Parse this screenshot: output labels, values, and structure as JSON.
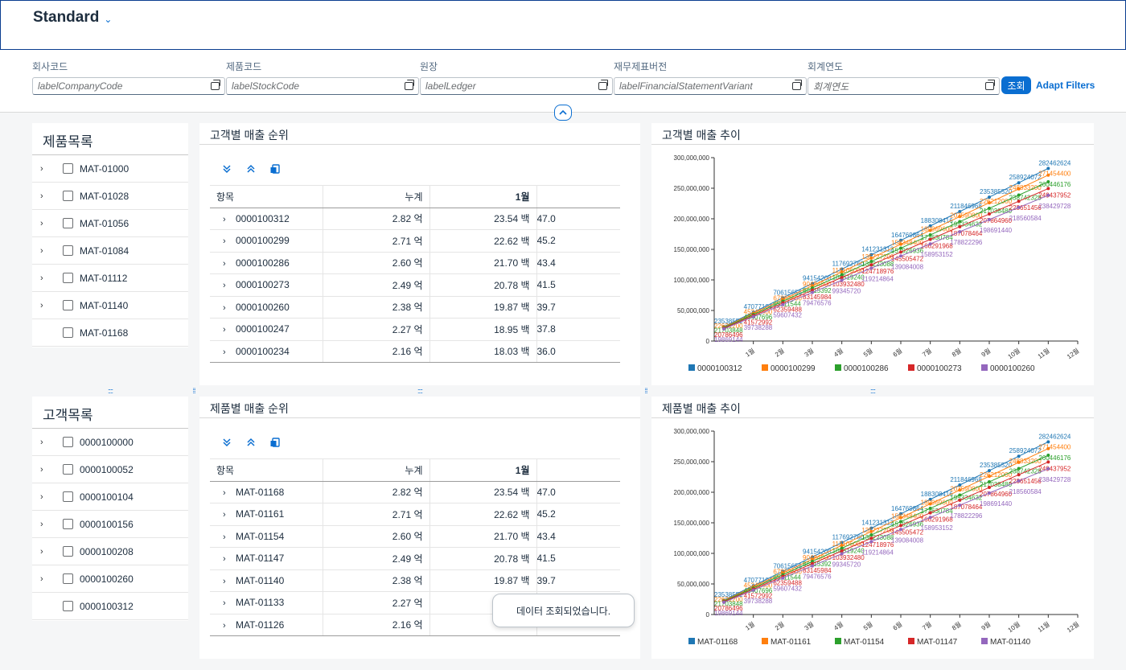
{
  "header": {
    "variant_title": "Standard"
  },
  "filters": {
    "fields": [
      {
        "label": "회사코드",
        "placeholder": "labelCompanyCode"
      },
      {
        "label": "제품코드",
        "placeholder": "labelStockCode"
      },
      {
        "label": "원장",
        "placeholder": "labelLedger"
      },
      {
        "label": "재무제표버전",
        "placeholder": "labelFinancialStatementVariant"
      },
      {
        "label": "회계연도",
        "placeholder": "회계연도"
      }
    ],
    "go_label": "조회",
    "adapt_label": "Adapt Filters"
  },
  "product_list": {
    "title": "제품목록",
    "items": [
      "MAT-01000",
      "MAT-01028",
      "MAT-01056",
      "MAT-01084",
      "MAT-01112",
      "MAT-01140",
      "MAT-01168"
    ]
  },
  "customer_list": {
    "title": "고객목록",
    "items": [
      "0000100000",
      "0000100052",
      "0000100104",
      "0000100156",
      "0000100208",
      "0000100260",
      "0000100312"
    ]
  },
  "customer_rank": {
    "title": "고객별 매출 순위",
    "columns": [
      "항목",
      "누계",
      "1월",
      ""
    ],
    "rows": [
      [
        "0000100312",
        "2.82 억",
        "23.54 백",
        "47.0"
      ],
      [
        "0000100299",
        "2.71 억",
        "22.62 백",
        "45.2"
      ],
      [
        "0000100286",
        "2.60 억",
        "21.70 백",
        "43.4"
      ],
      [
        "0000100273",
        "2.49 억",
        "20.78 백",
        "41.5"
      ],
      [
        "0000100260",
        "2.38 억",
        "19.87 백",
        "39.7"
      ],
      [
        "0000100247",
        "2.27 억",
        "18.95 백",
        "37.8"
      ],
      [
        "0000100234",
        "2.16 억",
        "18.03 백",
        "36.0"
      ]
    ]
  },
  "product_rank": {
    "title": "제품별 매출 순위",
    "columns": [
      "항목",
      "누계",
      "1월",
      ""
    ],
    "rows": [
      [
        "MAT-01168",
        "2.82 억",
        "23.54 백",
        "47.0"
      ],
      [
        "MAT-01161",
        "2.71 억",
        "22.62 백",
        "45.2"
      ],
      [
        "MAT-01154",
        "2.60 억",
        "21.70 백",
        "43.4"
      ],
      [
        "MAT-01147",
        "2.49 억",
        "20.78 백",
        "41.5"
      ],
      [
        "MAT-01140",
        "2.38 억",
        "19.87 백",
        "39.7"
      ],
      [
        "MAT-01133",
        "2.27 억",
        "",
        ""
      ],
      [
        "MAT-01126",
        "2.16 억",
        "",
        ""
      ]
    ]
  },
  "toast": {
    "message": "데이터 조회되었습니다."
  },
  "chart_data": [
    {
      "type": "line",
      "title": "고객별 매출 추이",
      "categories": [
        "1월",
        "2월",
        "3월",
        "4월",
        "5월",
        "6월",
        "7월",
        "8월",
        "9월",
        "10월",
        "11월",
        "12월"
      ],
      "ylim": [
        0,
        300000000
      ],
      "yticks": [
        "0",
        "50,000,000",
        "100,000,000",
        "150,000,000",
        "200,000,000",
        "250,000,000",
        "300,000,000"
      ],
      "legend_position": "bottom",
      "series": [
        {
          "name": "0000100312",
          "color": "#1f77b4",
          "values": [
            23538552,
            47077104,
            70615656,
            94154208,
            117692760,
            141231312,
            164769864,
            188308416,
            211846968,
            235385520,
            258924072,
            282462624
          ]
        },
        {
          "name": "0000100299",
          "color": "#ff7f0e",
          "values": [
            22621200,
            45242400,
            67863600,
            90484800,
            113106000,
            135727200,
            158348400,
            180969600,
            203590800,
            226212000,
            248833200,
            271454400
          ]
        },
        {
          "name": "0000100286",
          "color": "#2ca02c",
          "values": [
            21703848,
            43407696,
            65111544,
            86815392,
            108519240,
            130223088,
            151926936,
            173630784,
            195334632,
            217038480,
            238742328,
            260446176
          ]
        },
        {
          "name": "0000100273",
          "color": "#d62728",
          "values": [
            20786496,
            41572992,
            62359488,
            83145984,
            103932480,
            124718976,
            145505472,
            166291968,
            187078464,
            207864960,
            228651456,
            249437952
          ]
        },
        {
          "name": "0000100260",
          "color": "#9467bd",
          "values": [
            19869144,
            39738288,
            59607432,
            79476576,
            99345720,
            119214864,
            139084008,
            158953152,
            178822296,
            198691440,
            218560584,
            238429728
          ]
        }
      ]
    },
    {
      "type": "line",
      "title": "제품별 매출 추이",
      "categories": [
        "1월",
        "2월",
        "3월",
        "4월",
        "5월",
        "6월",
        "7월",
        "8월",
        "9월",
        "10월",
        "11월",
        "12월"
      ],
      "ylim": [
        0,
        300000000
      ],
      "yticks": [
        "0",
        "50,000,000",
        "100,000,000",
        "150,000,000",
        "200,000,000",
        "250,000,000",
        "300,000,000"
      ],
      "legend_position": "bottom",
      "series": [
        {
          "name": "MAT-01168",
          "color": "#1f77b4",
          "values": [
            23538552,
            47077104,
            70615656,
            94154208,
            117692760,
            141231312,
            164769864,
            188308416,
            211846968,
            235385520,
            258924072,
            282462624
          ]
        },
        {
          "name": "MAT-01161",
          "color": "#ff7f0e",
          "values": [
            22621200,
            45242400,
            67863600,
            90484800,
            113106000,
            135727200,
            158348400,
            180969600,
            203590800,
            226212000,
            248833200,
            271454400
          ]
        },
        {
          "name": "MAT-01154",
          "color": "#2ca02c",
          "values": [
            21703848,
            43407696,
            65111544,
            86815392,
            108519240,
            130223088,
            151926936,
            173630784,
            195334632,
            217038480,
            238742328,
            260446176
          ]
        },
        {
          "name": "MAT-01147",
          "color": "#d62728",
          "values": [
            20786496,
            41572992,
            62359488,
            83145984,
            103932480,
            124718976,
            145505472,
            166291968,
            187078464,
            207864960,
            228651456,
            249437952
          ]
        },
        {
          "name": "MAT-01140",
          "color": "#9467bd",
          "values": [
            19869144,
            39738288,
            59607432,
            79476576,
            99345720,
            119214864,
            139084008,
            158953152,
            178822296,
            198691440,
            218560584,
            238429728
          ]
        }
      ]
    }
  ]
}
